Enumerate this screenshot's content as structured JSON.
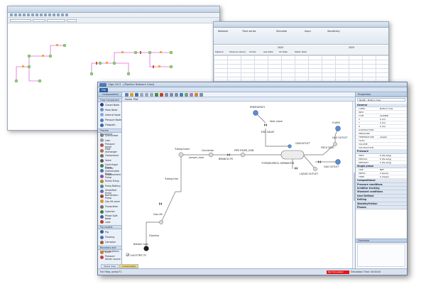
{
  "back_network": {
    "nodes": [
      "PIPE",
      "SOURCE",
      "SINK",
      "NODE"
    ]
  },
  "back_spreadsheet": {
    "ribbon_items": [
      "Network",
      "Time series",
      "Simulate",
      "Input",
      "Sensitivity"
    ],
    "year_labels": [
      "2020",
      "2025"
    ],
    "col_headers": [
      "Pipeline",
      "Pressure (bara)",
      "Choke",
      "Gas Rate",
      "Oil Rate",
      "Water Rate"
    ]
  },
  "main": {
    "title": "Olga 2017 - [Pipeline Network Case]",
    "file_tab": "File",
    "doc_tabs": [
      "Home",
      "Plot"
    ],
    "left_panel": {
      "header": "Components",
      "groups": [
        {
          "label": "Flow Component",
          "items": [
            {
              "label": "Closed Node",
              "color": "#2f3c8c"
            },
            {
              "label": "Mass Node",
              "color": "#6a8fc8"
            },
            {
              "label": "Internal Node",
              "color": "#8aa6d6"
            },
            {
              "label": "Pressure Node",
              "color": "#4f7fc2"
            },
            {
              "label": "Flowpath",
              "color": "#3a66aa"
            }
          ]
        },
        {
          "label": "Process Equipment",
          "items": [
            {
              "label": "Checkvalve",
              "color": "#7d7d7d"
            },
            {
              "label": "Loss",
              "color": "#9a9a9a"
            },
            {
              "label": "Pressure boost",
              "color": "#b04b4b"
            },
            {
              "label": "Heat exchanger",
              "color": "#c06a2b"
            },
            {
              "label": "Compressor",
              "color": "#6f6f6f"
            },
            {
              "label": "Valve",
              "color": "#5a5a5a"
            },
            {
              "label": "Centrifugal Pump",
              "color": "#3f7f3f"
            },
            {
              "label": "Electric Submersible Pump",
              "color": "#4a6fb0"
            },
            {
              "label": "Displacement Pump",
              "color": "#8a4fa0"
            },
            {
              "label": "Points Pump",
              "color": "#b08a2b"
            },
            {
              "label": "Pump Battery",
              "color": "#4a8a8a"
            },
            {
              "label": "Simplified Pump",
              "color": "#6a6ab0"
            },
            {
              "label": "Bornemann Pump",
              "color": "#a04040"
            },
            {
              "label": "Gas lift valve",
              "color": "#d0a020"
            },
            {
              "label": "Transmitter",
              "color": "#707070"
            },
            {
              "label": "Injection",
              "color": "#408040"
            },
            {
              "label": "Phase Split Node",
              "color": "#4060a0"
            },
            {
              "label": "Leak",
              "color": "#c04020"
            }
          ]
        },
        {
          "label": "Pig models",
          "items": [
            {
              "label": "Pig",
              "color": "#3060a0"
            },
            {
              "label": "Tracking",
              "color": "#5070b0"
            },
            {
              "label": "Corrosion",
              "color": "#a06030"
            }
          ]
        },
        {
          "label": "Boundary and Initial Conditions",
          "items": [
            {
              "label": "Zone",
              "color": "#d08020"
            },
            {
              "label": "Pressure driven source",
              "color": "#c04040"
            }
          ]
        }
      ]
    },
    "bottom_tabs": [
      "Model View",
      "Components"
    ],
    "canvas": {
      "layout_checkbox": "Layout Net On",
      "labels": {
        "emergency": "EMERGENCY",
        "flare": "FLARE",
        "tubing_head": "Tubing head",
        "jumper_riser": "jumper_riser",
        "connector": "Connector",
        "branch": "BRANCH-FR",
        "pipe_riser": "PIPE RISER_HUB",
        "separator": "TOPSIDE/PROC-SEPARATOR",
        "gas_outlet_top": "GAS OUTLET",
        "gas_outlet": "GASOUTLET",
        "liquid_outlet": "LIQUID OUTLET",
        "gas_outlet2": "GAS OUTLET",
        "frcv": "FRCV-2010",
        "tubing_tree": "Tubing tree",
        "gas_lift": "Gas Lift",
        "bottom_node": "Bottom hole",
        "flowline": "Flowline",
        "vent_valve": "Vent valve",
        "emergency_valve": "ESD VALVE"
      }
    },
    "properties": {
      "header": "Properties",
      "selector": "NODE - Bottom hole",
      "categories": [
        "General",
        "Pressure",
        "Single phase",
        "Compositional",
        "Pressure conditions",
        "Inhibitor tracking",
        "Standard conditions",
        "User-Defined",
        "Drilling",
        "Wastebyfriction",
        "Phases"
      ],
      "general_rows": [
        {
          "k": "LABEL",
          "v": "Bottom hole"
        },
        {
          "k": "INFO",
          "v": ""
        },
        {
          "k": "TYPE",
          "v": "CLOSED"
        },
        {
          "k": "X",
          "v": "0 (m)"
        },
        {
          "k": "Y",
          "v": "0 (m)"
        },
        {
          "k": "Z",
          "v": "0 (m)"
        },
        {
          "k": "GASFRACTION",
          "v": ""
        },
        {
          "k": "PRESSURE",
          "v": ""
        },
        {
          "k": "TEMPERATURE",
          "v": "(degC)"
        },
        {
          "k": "FLUID",
          "v": ""
        },
        {
          "k": "VOLUME",
          "v": ""
        },
        {
          "k": "VOLFRACTION",
          "v": ""
        }
      ],
      "pressure_rows": [
        {
          "k": "PRES",
          "v": "0 (Pa a/kg)"
        },
        {
          "k": "PRESOIL",
          "v": "0 (Pa a/kg)"
        },
        {
          "k": "PRESWAT",
          "v": "0 (Pa a/kg)"
        }
      ],
      "single_rows": [
        {
          "k": "LINE",
          "v": "NET"
        },
        {
          "k": "PRESS",
          "v": "0 (bara)"
        },
        {
          "k": "TEMP",
          "v": "0 (degC)"
        }
      ],
      "overview_header": "Overview"
    },
    "status": {
      "help": "For Help, press F1",
      "red_box": "Not Simulated",
      "simulation": "Simulation Time: 00:00:00"
    }
  }
}
